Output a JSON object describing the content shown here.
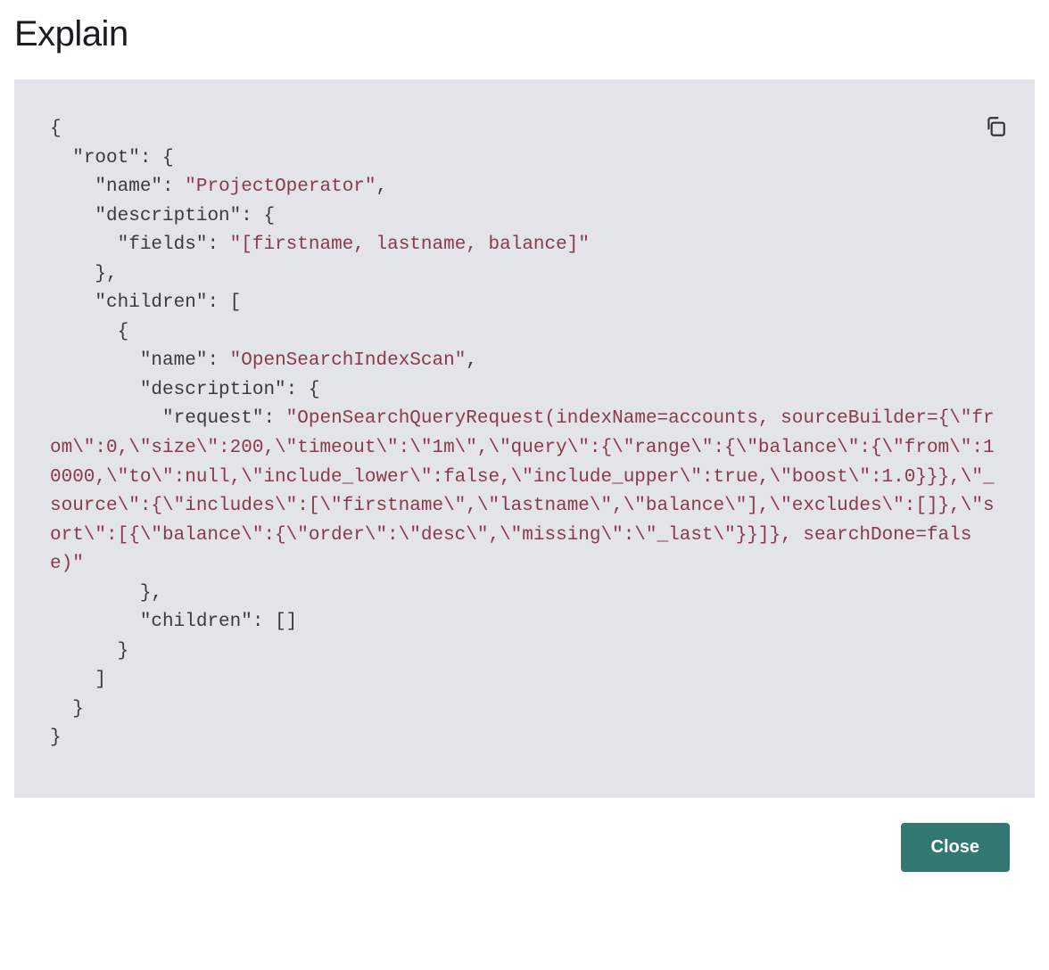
{
  "modal": {
    "title": "Explain",
    "close_label": "Close"
  },
  "code": {
    "lines": [
      {
        "indent": 0,
        "prefix": "{",
        "key": null,
        "value": null,
        "suffix": ""
      },
      {
        "indent": 1,
        "prefix": "",
        "key": "\"root\"",
        "value": null,
        "suffix": ": {"
      },
      {
        "indent": 2,
        "prefix": "",
        "key": "\"name\"",
        "value": "\"ProjectOperator\"",
        "suffix": ","
      },
      {
        "indent": 2,
        "prefix": "",
        "key": "\"description\"",
        "value": null,
        "suffix": ": {"
      },
      {
        "indent": 3,
        "prefix": "",
        "key": "\"fields\"",
        "value": "\"[firstname, lastname, balance]\"",
        "suffix": ""
      },
      {
        "indent": 2,
        "prefix": "},",
        "key": null,
        "value": null,
        "suffix": ""
      },
      {
        "indent": 2,
        "prefix": "",
        "key": "\"children\"",
        "value": null,
        "suffix": ": ["
      },
      {
        "indent": 3,
        "prefix": "{",
        "key": null,
        "value": null,
        "suffix": ""
      },
      {
        "indent": 4,
        "prefix": "",
        "key": "\"name\"",
        "value": "\"OpenSearchIndexScan\"",
        "suffix": ","
      },
      {
        "indent": 4,
        "prefix": "",
        "key": "\"description\"",
        "value": null,
        "suffix": ": {"
      },
      {
        "indent": 5,
        "prefix": "",
        "key": "\"request\"",
        "value": "\"OpenSearchQueryRequest(indexName=accounts, sourceBuilder={\\\"from\\\":0,\\\"size\\\":200,\\\"timeout\\\":\\\"1m\\\",\\\"query\\\":{\\\"range\\\":{\\\"balance\\\":{\\\"from\\\":10000,\\\"to\\\":null,\\\"include_lower\\\":false,\\\"include_upper\\\":true,\\\"boost\\\":1.0}}},\\\"_source\\\":{\\\"includes\\\":[\\\"firstname\\\",\\\"lastname\\\",\\\"balance\\\"],\\\"excludes\\\":[]},\\\"sort\\\":[{\\\"balance\\\":{\\\"order\\\":\\\"desc\\\",\\\"missing\\\":\\\"_last\\\"}}]}, searchDone=false)\"",
        "suffix": "",
        "wrap": true
      },
      {
        "indent": 4,
        "prefix": "},",
        "key": null,
        "value": null,
        "suffix": ""
      },
      {
        "indent": 4,
        "prefix": "",
        "key": "\"children\"",
        "value": null,
        "suffix": ": []"
      },
      {
        "indent": 3,
        "prefix": "}",
        "key": null,
        "value": null,
        "suffix": ""
      },
      {
        "indent": 2,
        "prefix": "]",
        "key": null,
        "value": null,
        "suffix": ""
      },
      {
        "indent": 1,
        "prefix": "}",
        "key": null,
        "value": null,
        "suffix": ""
      },
      {
        "indent": 0,
        "prefix": "}",
        "key": null,
        "value": null,
        "suffix": ""
      }
    ]
  }
}
